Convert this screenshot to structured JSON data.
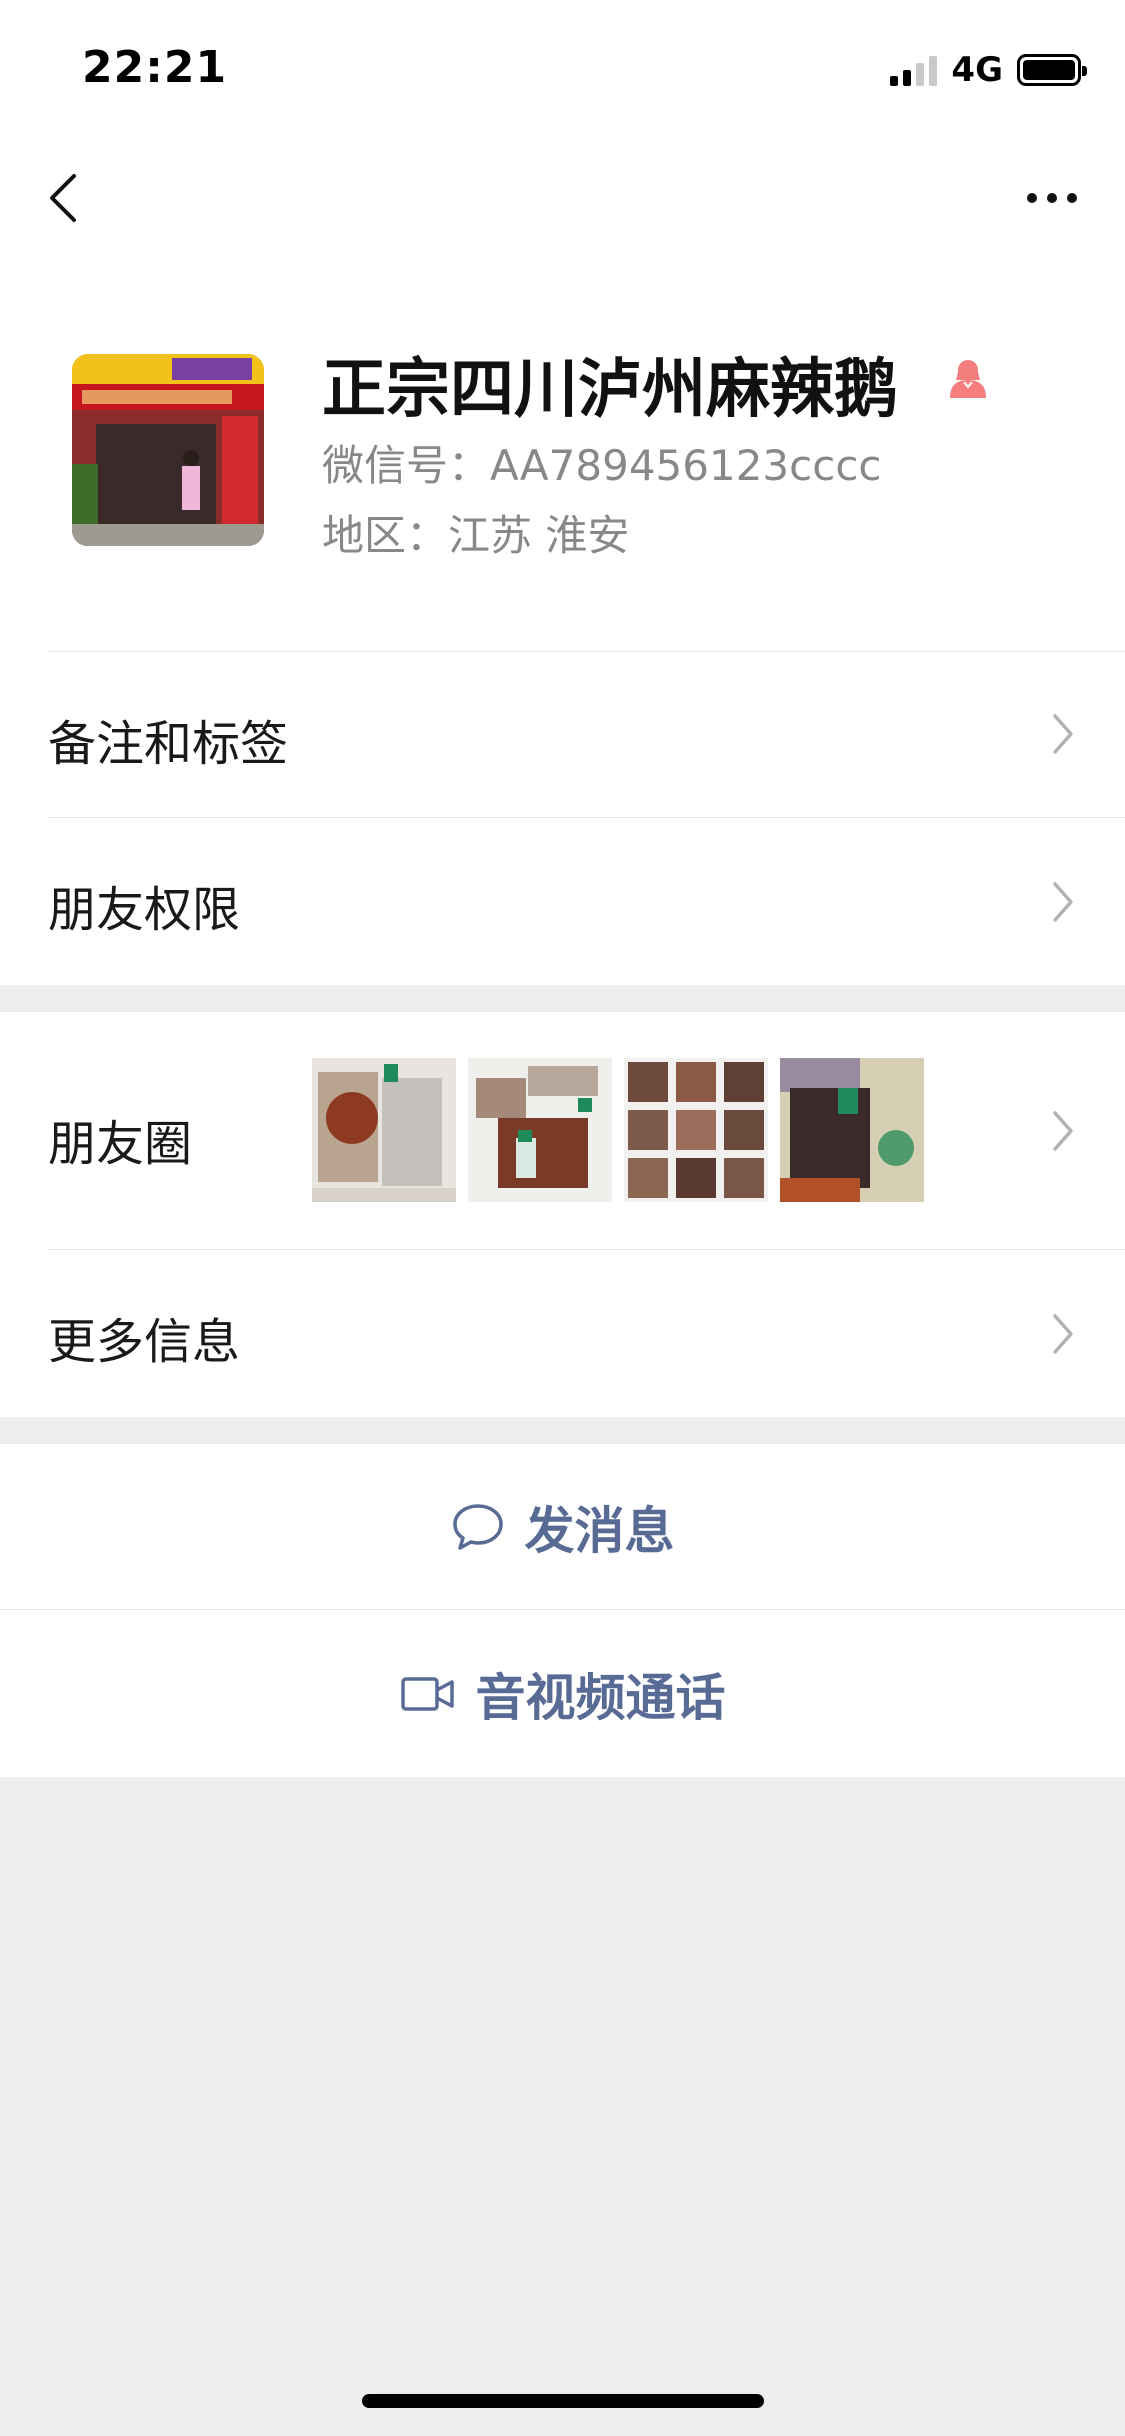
{
  "status_bar": {
    "time": "22:21",
    "network": "4G"
  },
  "profile": {
    "name": "正宗四川泸州麻辣鹅",
    "wechat_id_label": "微信号：",
    "wechat_id": "AA789456123cccc",
    "region_label": "地区：",
    "region": "江苏 淮安",
    "gender_icon": "female-icon",
    "gender_color": "#f37e7d"
  },
  "menu": {
    "remarks_tags": "备注和标签",
    "friend_permissions": "朋友权限",
    "moments": "朋友圈",
    "more_info": "更多信息"
  },
  "actions": {
    "send_message": "发消息",
    "video_call": "音视频通话"
  },
  "colors": {
    "link": "#576b95",
    "page_bg": "#ededed",
    "secondary_text": "#888888"
  }
}
